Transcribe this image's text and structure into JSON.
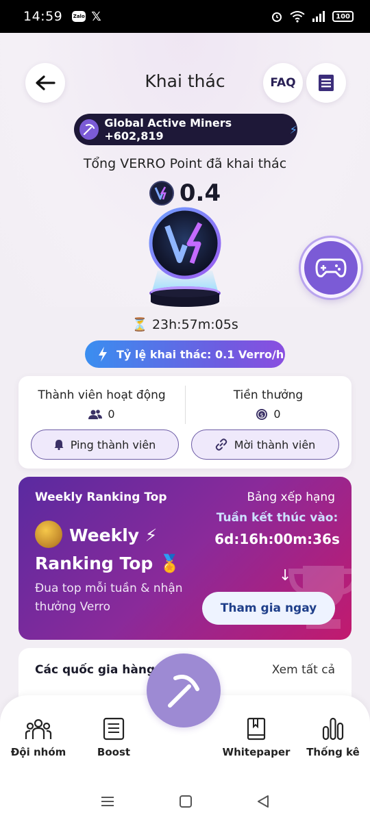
{
  "status_bar": {
    "time": "14:59",
    "app_icons": [
      "zalo-icon",
      "x-icon"
    ],
    "battery": "100"
  },
  "header": {
    "title": "Khai thác",
    "faq_label": "FAQ"
  },
  "miners": {
    "text": "Global Active Miners +602,819"
  },
  "total": {
    "label": "Tổng VERRO Point đã khai thác",
    "value": "0.4"
  },
  "timer": "23h:57m:05s",
  "rate": {
    "label": "Tỷ lệ khai thác: 0.1 Verro/h"
  },
  "members": {
    "active_label": "Thành viên hoạt động",
    "active_value": "0",
    "reward_label": "Tiền thưởng",
    "reward_value": "0",
    "ping_label": "Ping thành viên",
    "invite_label": "Mời thành viên"
  },
  "weekly": {
    "title": "Weekly Ranking Top",
    "ranking_link": "Bảng xếp hạng",
    "ends_label": "Tuần kết thúc vào:",
    "countdown": "6d:16h:00m:36s",
    "big_title_1": "Weekly ⚡",
    "big_title_2": "Ranking Top 🏅",
    "description": "Đua top mỗi tuần & nhận thưởng Verro",
    "join_label": "Tham gia ngay"
  },
  "countries": {
    "title": "Các quốc gia hàng",
    "see_all": "Xem tất cả"
  },
  "bottom_nav": {
    "team": "Đội nhóm",
    "boost": "Boost",
    "whitepaper": "Whitepaper",
    "stats": "Thống kê"
  },
  "colors": {
    "accent": "#7b5bd6",
    "dark_pill": "#1e1838",
    "weekly_start": "#5a2aa0",
    "weekly_end": "#c21a6e"
  }
}
